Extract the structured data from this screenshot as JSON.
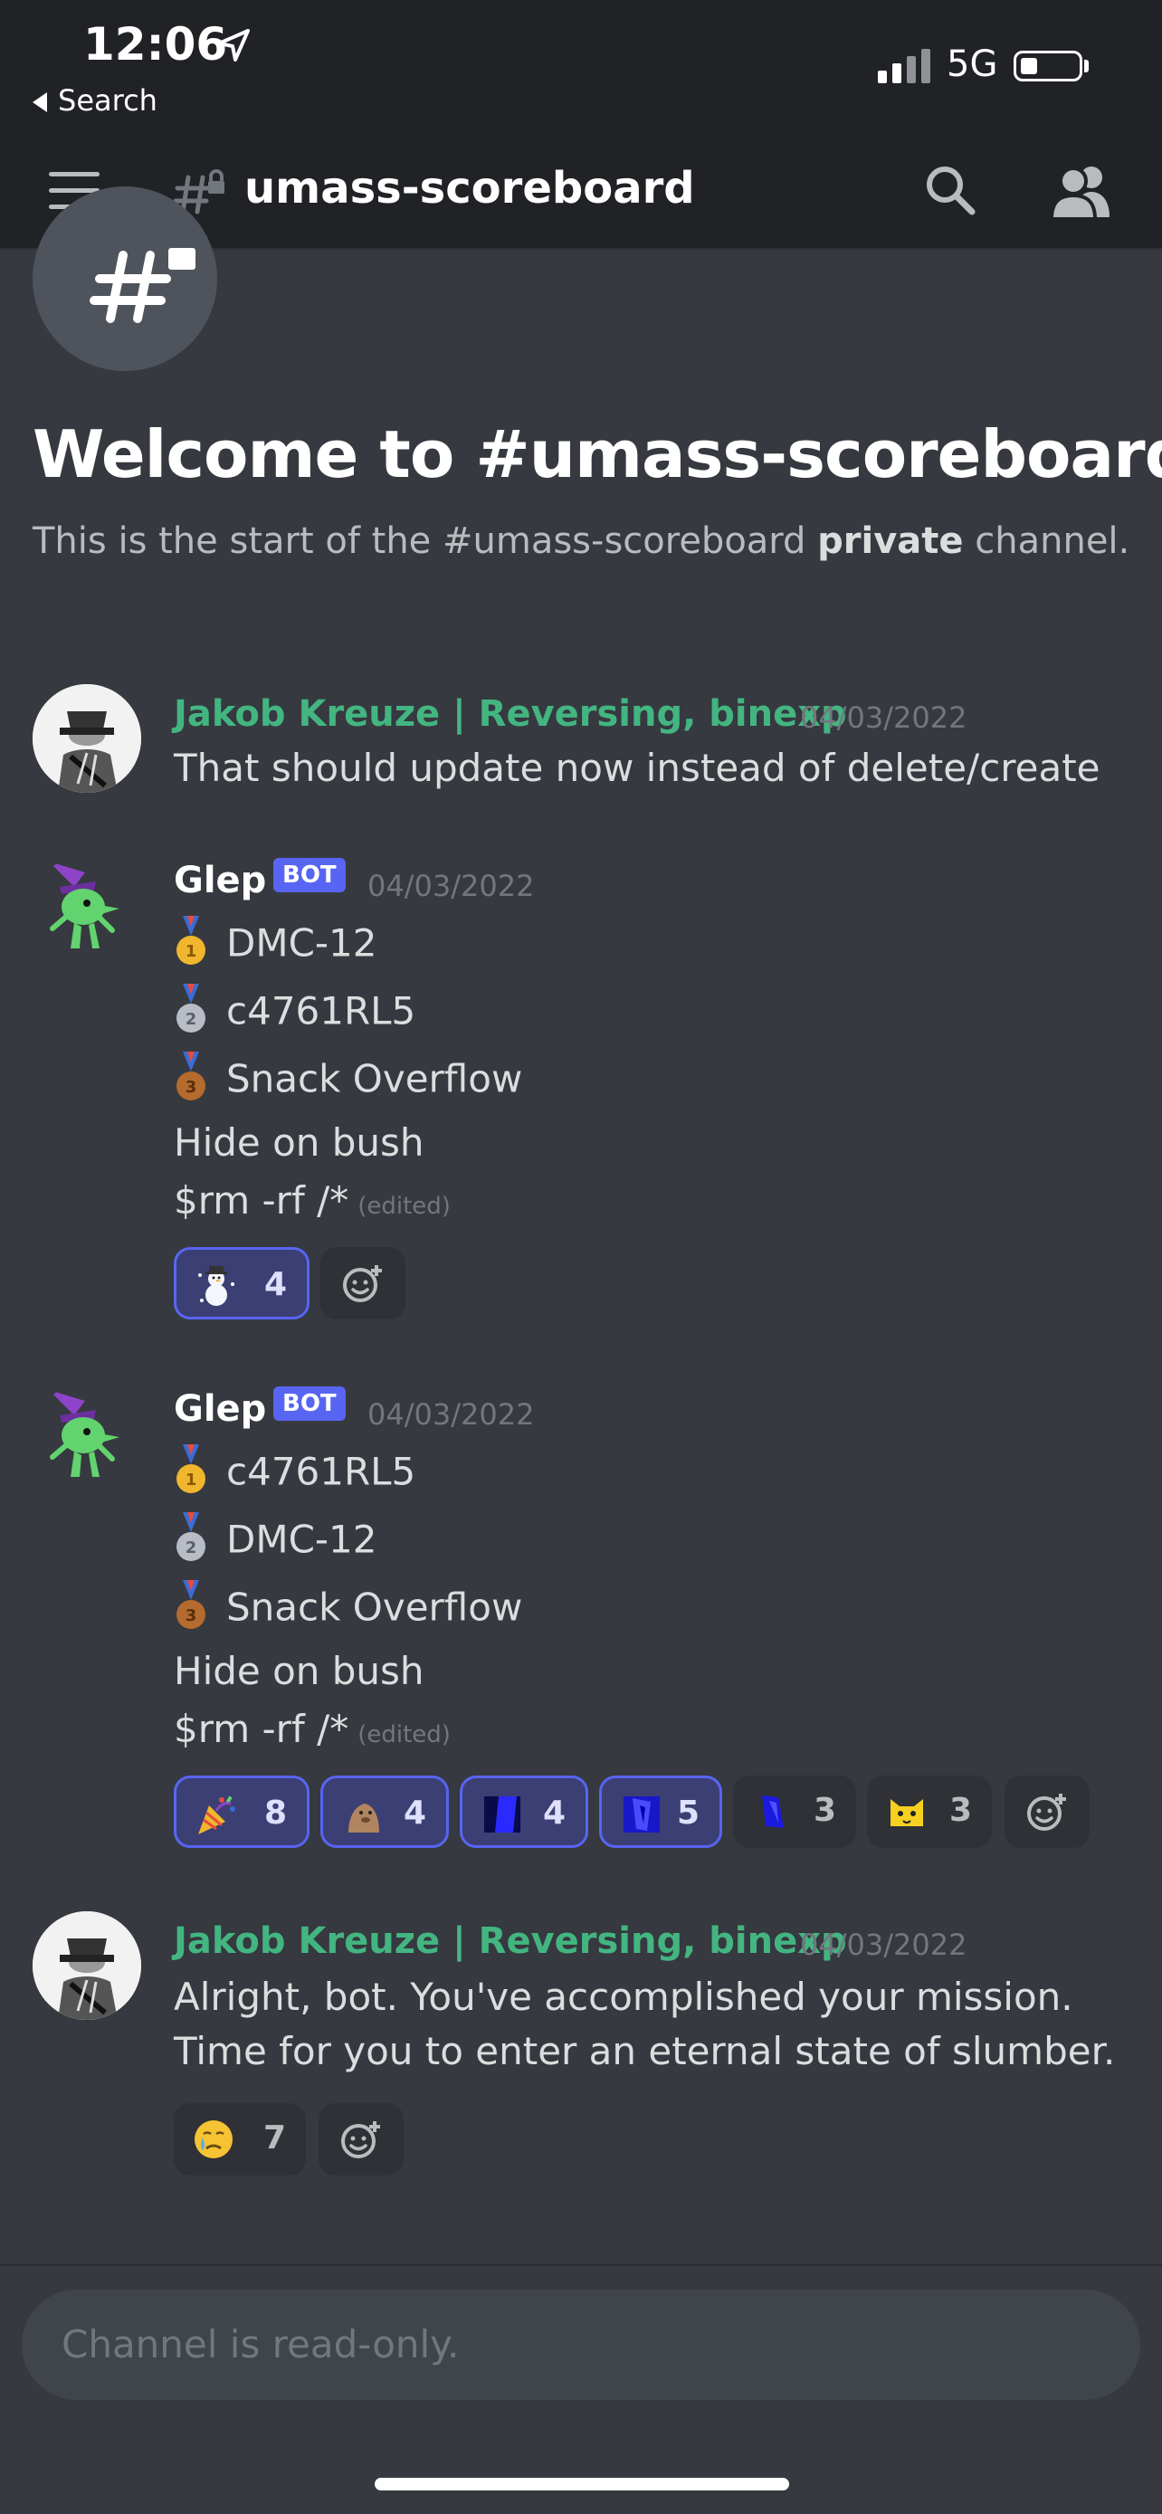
{
  "status_bar": {
    "time": "12:06",
    "back_label": "Search",
    "network": "5G"
  },
  "header": {
    "channel_name": "umass-scoreboard"
  },
  "welcome": {
    "title": "Welcome to #umass-scoreboard!",
    "subtitle_prefix": "This is the start of the #umass-scoreboard ",
    "subtitle_bold": "private",
    "subtitle_suffix": " channel."
  },
  "messages": [
    {
      "author": "Jakob Kreuze | Reversing, binexp",
      "timestamp": "04/03/2022",
      "text": "That should update now instead of delete/create"
    },
    {
      "author": "Glep",
      "badge": "BOT",
      "timestamp": "04/03/2022",
      "rankings": [
        "DMC-12",
        "c4761RL5",
        "Snack Overflow"
      ],
      "line4": "Hide on bush",
      "line5": "$rm -rf /*",
      "edited": "(edited)",
      "reactions": [
        {
          "icon": "snowman-emoji",
          "count": "4"
        }
      ]
    },
    {
      "author": "Glep",
      "badge": "BOT",
      "timestamp": "04/03/2022",
      "rankings": [
        "c4761RL5",
        "DMC-12",
        "Snack Overflow"
      ],
      "line4": "Hide on bush",
      "line5": "$rm -rf /*",
      "edited": "(edited)",
      "reactions": [
        {
          "icon": "party-popper-emoji",
          "count": "8"
        },
        {
          "icon": "custom-emoji-animal",
          "count": "4"
        },
        {
          "icon": "custom-emoji-blue-1",
          "count": "4"
        },
        {
          "icon": "custom-emoji-blue-2",
          "count": "5"
        },
        {
          "icon": "custom-emoji-blue-3",
          "count": "3"
        },
        {
          "icon": "custom-emoji-yellow-cat",
          "count": "3"
        }
      ]
    },
    {
      "author": "Jakob Kreuze | Reversing, binexp",
      "timestamp": "04/03/2022",
      "text_line1": "Alright, bot. You've accomplished your mission.",
      "text_line2": "Time for you to enter an eternal state of slumber.",
      "reactions": [
        {
          "icon": "crying-face-emoji",
          "count": "7"
        }
      ]
    }
  ],
  "input": {
    "placeholder": "Channel is read-only."
  },
  "colors": {
    "background": "#36393f",
    "header": "#202225",
    "username_green": "#43b581",
    "bot_badge": "#5865f2",
    "timestamp": "#72767d"
  }
}
